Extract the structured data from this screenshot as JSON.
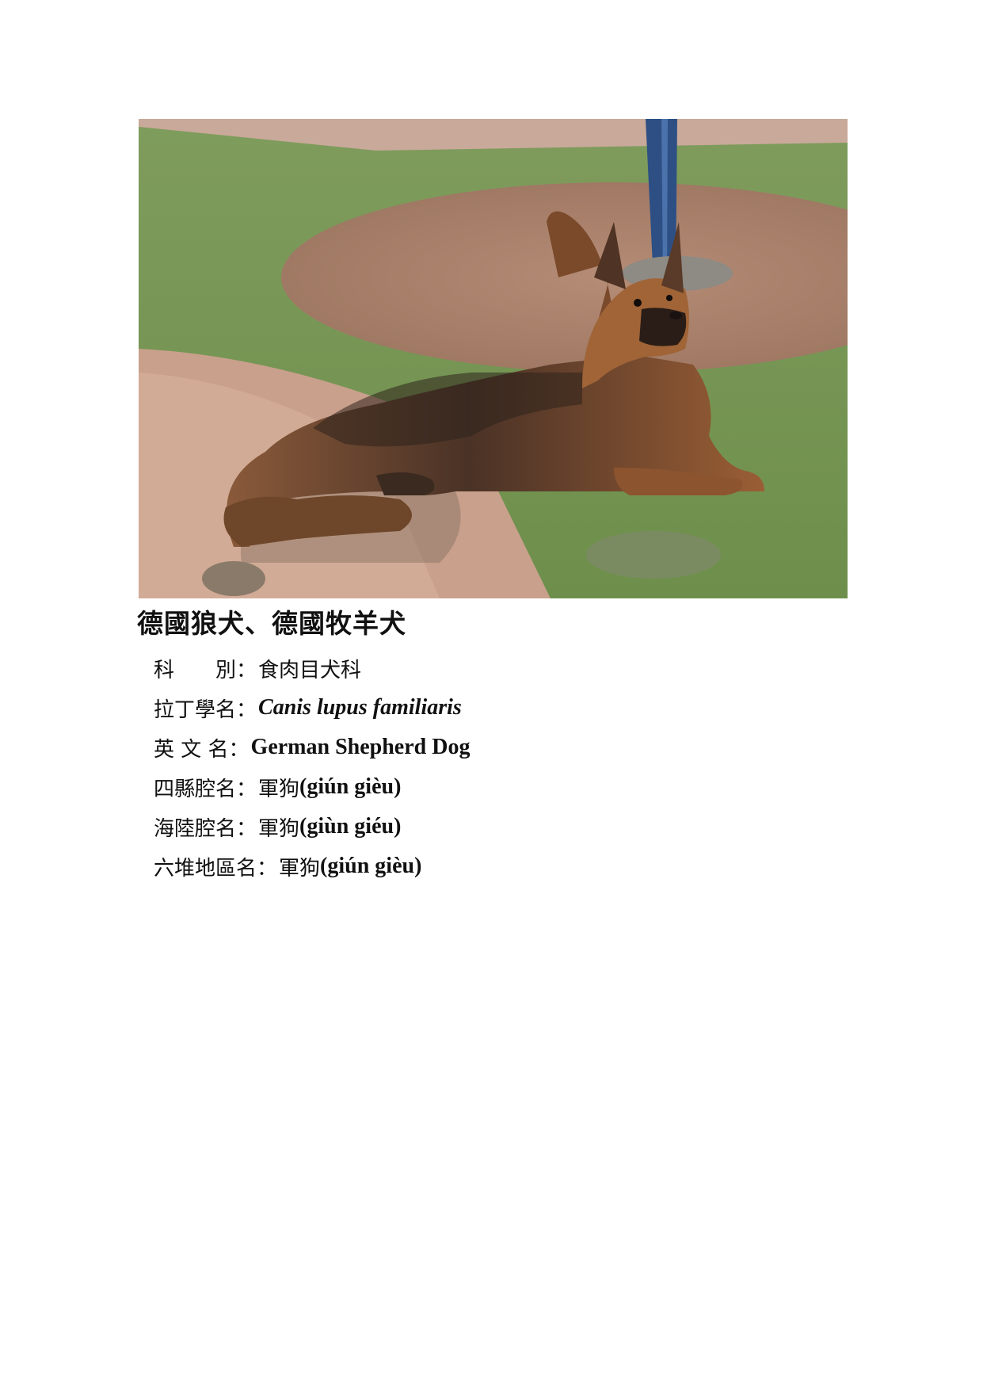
{
  "title": "德國狼犬、德國牧羊犬",
  "photo": {
    "subject": "german-shepherd-dog-lying-on-ground"
  },
  "rows": [
    {
      "label": "科　　別",
      "value": "食肉目犬科",
      "style": "cjk"
    },
    {
      "label": "拉丁學名",
      "value": "Canis lupus familiaris",
      "style": "italic"
    },
    {
      "label": "英 文 名",
      "value": "German Shepherd Dog",
      "style": "latin"
    },
    {
      "label": "四縣腔名",
      "value_cjk": "軍狗",
      "value_latin": "(giún gièu)"
    },
    {
      "label": "海陸腔名",
      "value_cjk": "軍狗",
      "value_latin": "(giùn giéu)"
    },
    {
      "label": "六堆地區名",
      "value_cjk": "軍狗",
      "value_latin": "(giún gièu)"
    }
  ],
  "colon": "："
}
